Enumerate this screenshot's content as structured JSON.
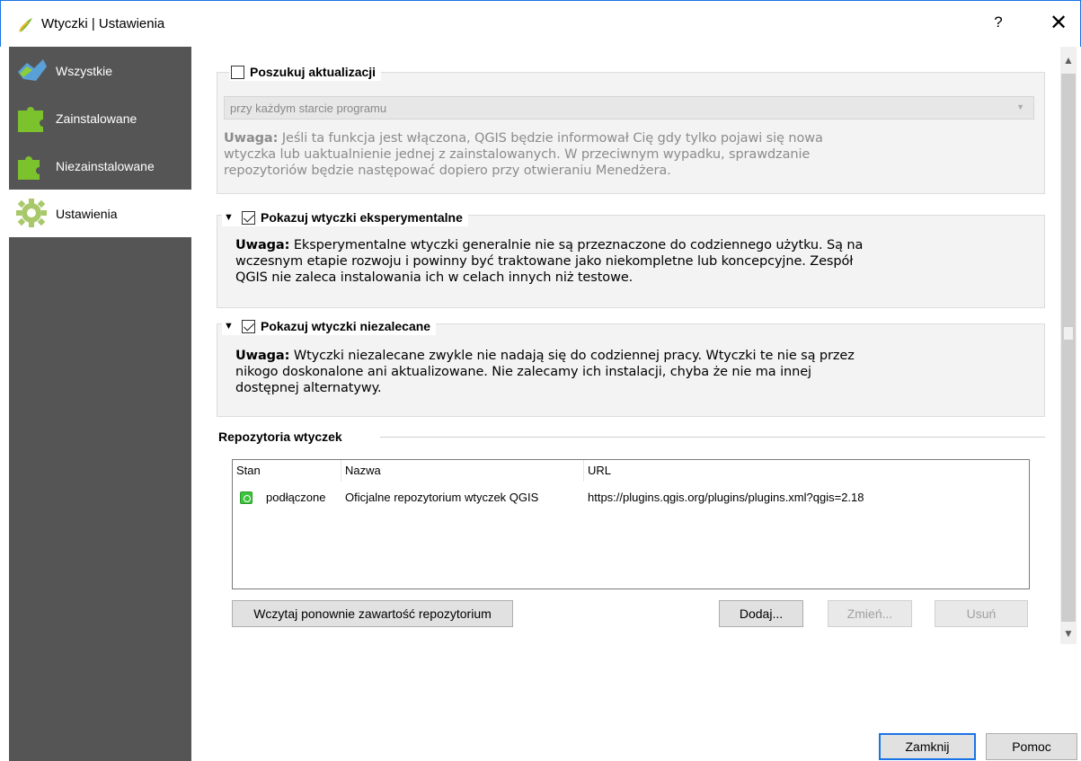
{
  "window": {
    "title": "Wtyczki | Ustawienia",
    "help_label": "?",
    "close_label": "✕"
  },
  "sidebar": {
    "items": [
      {
        "label": "Wszystkie",
        "icon": "all-plugins-icon"
      },
      {
        "label": "Zainstalowane",
        "icon": "installed-plugin-icon"
      },
      {
        "label": "Niezainstalowane",
        "icon": "not-installed-plugin-icon"
      },
      {
        "label": "Ustawienia",
        "icon": "settings-gear-icon",
        "active": true
      }
    ]
  },
  "updates": {
    "label": "Poszukuj aktualizacji",
    "checked": false,
    "frequency_value": "przy każdym starcie programu",
    "note_bold": "Uwaga:",
    "note_lines": [
      " Jeśli ta funkcja jest włączona, QGIS będzie informował Cię gdy tylko pojawi się nowa",
      "wtyczka lub uaktualnienie jednej z zainstalowanych. W przeciwnym wypadku, sprawdzanie",
      "repozytoriów będzie następować dopiero przy otwieraniu Menedżera."
    ]
  },
  "experimental": {
    "label": "Pokazuj wtyczki eksperymentalne",
    "checked": true,
    "note_bold": "Uwaga:",
    "note_lines": [
      " Eksperymentalne wtyczki generalnie nie są przeznaczone do codziennego użytku. Są na",
      "wczesnym etapie rozwoju i powinny być traktowane jako niekompletne lub koncepcyjne. Zespół",
      "QGIS nie zaleca instalowania ich w celach innych niż testowe."
    ]
  },
  "deprecated": {
    "label": "Pokazuj wtyczki niezalecane",
    "checked": true,
    "note_bold": "Uwaga:",
    "note_lines": [
      " Wtyczki niezalecane zwykle nie nadają się do codziennej pracy. Wtyczki te nie są przez",
      "nikogo doskonalone ani aktualizowane. Nie zalecamy ich instalacji, chyba że nie ma innej",
      "dostępnej alternatywy."
    ]
  },
  "repositories": {
    "section_label": "Repozytoria wtyczek",
    "columns": [
      "Stan",
      "Nazwa",
      "URL"
    ],
    "rows": [
      {
        "status": "podłączone",
        "name": "Oficjalne repozytorium wtyczek QGIS",
        "url": "https://plugins.qgis.org/plugins/plugins.xml?qgis=2.18"
      }
    ],
    "reload_label": "Wczytaj ponownie zawartość repozytorium",
    "add_label": "Dodaj...",
    "edit_label": "Zmień...",
    "delete_label": "Usuń"
  },
  "footer": {
    "close_label": "Zamknij",
    "help_label": "Pomoc"
  },
  "colors": {
    "sidebar_bg": "#555555",
    "accent": "#1a73e8",
    "status_ok": "#3ec43e"
  }
}
